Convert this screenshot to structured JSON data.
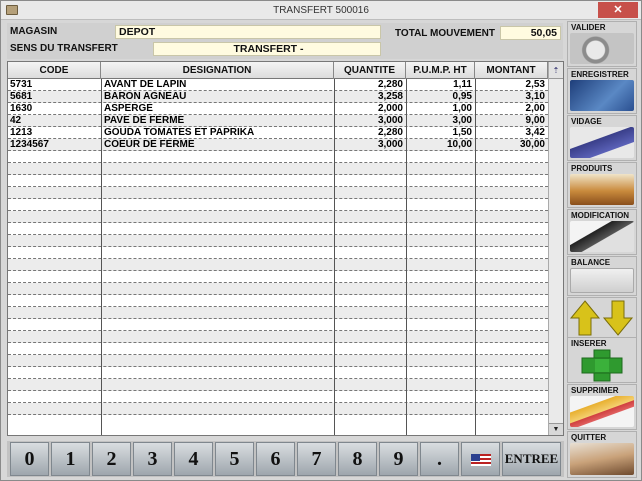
{
  "window": {
    "title": "TRANSFERT 500016",
    "close_glyph": "✕"
  },
  "header": {
    "magasin_label": "MAGASIN",
    "magasin_value": "DEPOT",
    "sens_label": "SENS DU TRANSFERT",
    "sens_value": "TRANSFERT -",
    "total_label": "TOTAL MOUVEMENT",
    "total_value": "50,05"
  },
  "grid": {
    "columns": [
      "CODE",
      "DESIGNATION",
      "QUANTITE",
      "P.U.M.P. HT",
      "MONTANT"
    ],
    "rows": [
      {
        "code": "5731",
        "designation": "AVANT DE LAPIN",
        "quantite": "2,280",
        "pump": "1,11",
        "montant": "2,53"
      },
      {
        "code": "5681",
        "designation": "BARON AGNEAU",
        "quantite": "3,258",
        "pump": "0,95",
        "montant": "3,10"
      },
      {
        "code": "1630",
        "designation": "ASPERGE",
        "quantite": "2,000",
        "pump": "1,00",
        "montant": "2,00"
      },
      {
        "code": "42",
        "designation": "PAVE DE FERME",
        "quantite": "3,000",
        "pump": "3,00",
        "montant": "9,00"
      },
      {
        "code": "1213",
        "designation": "GOUDA  TOMATES ET PAPRIKA",
        "quantite": "2,280",
        "pump": "1,50",
        "montant": "3,42"
      },
      {
        "code": "1234567",
        "designation": "COEUR DE FERME",
        "quantite": "3,000",
        "pump": "10,00",
        "montant": "30,00"
      }
    ],
    "empty_rows": 22
  },
  "keypad": {
    "keys": [
      "0",
      "1",
      "2",
      "3",
      "4",
      "5",
      "6",
      "7",
      "8",
      "9",
      "."
    ],
    "entree_label": "ENTREE"
  },
  "side_buttons": {
    "valider": "VALIDER",
    "enregistrer": "ENREGISTRER",
    "vidage": "VIDAGE",
    "produits": "PRODUITS",
    "modification": "MODIFICATION",
    "balance": "BALANCE",
    "inserer": "INSERER",
    "supprimer": "SUPPRIMER",
    "quitter": "QUITTER"
  },
  "colors": {
    "field_bg": "#fffbe0",
    "close_red": "#c7504a",
    "plus_green": "#2f9a2f",
    "arrow_yellow": "#d8c21a"
  }
}
